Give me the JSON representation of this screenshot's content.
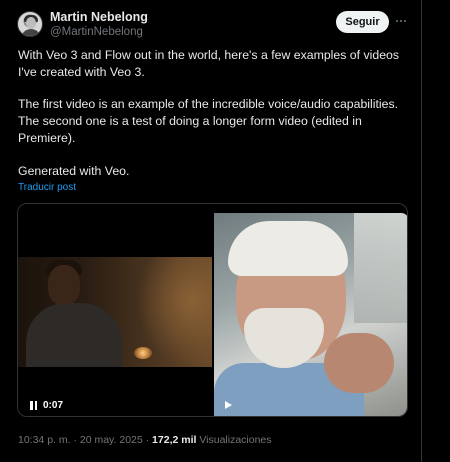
{
  "author": {
    "name": "Martin Nebelong",
    "handle": "@MartinNebelong"
  },
  "actions": {
    "follow_label": "Seguir",
    "more_icon": "more-horizontal-icon"
  },
  "post": {
    "paragraph_1": "With Veo 3 and Flow out in the world, here's a few examples of videos I've created with Veo 3.",
    "paragraph_2": "The first video is an example of the incredible voice/audio capabilities. The second one is a test of doing a longer form video (edited in Premiere).",
    "paragraph_3": "Generated with Veo.",
    "translate_label": "Traducir post"
  },
  "media": {
    "video_1": {
      "state": "playing",
      "timestamp": "0:07",
      "control_icon": "pause-icon"
    },
    "video_2": {
      "state": "paused",
      "control_icon": "play-icon"
    }
  },
  "footer": {
    "timestamp": "10:34 p. m. · 20 may. 2025 · ",
    "views_count": "172,2 mil",
    "views_label": " Visualizaciones"
  },
  "colors": {
    "background": "#000000",
    "text_primary": "#e7e9ea",
    "text_secondary": "#71767b",
    "link": "#1d9bf0",
    "button_bg": "#eff3f4"
  }
}
